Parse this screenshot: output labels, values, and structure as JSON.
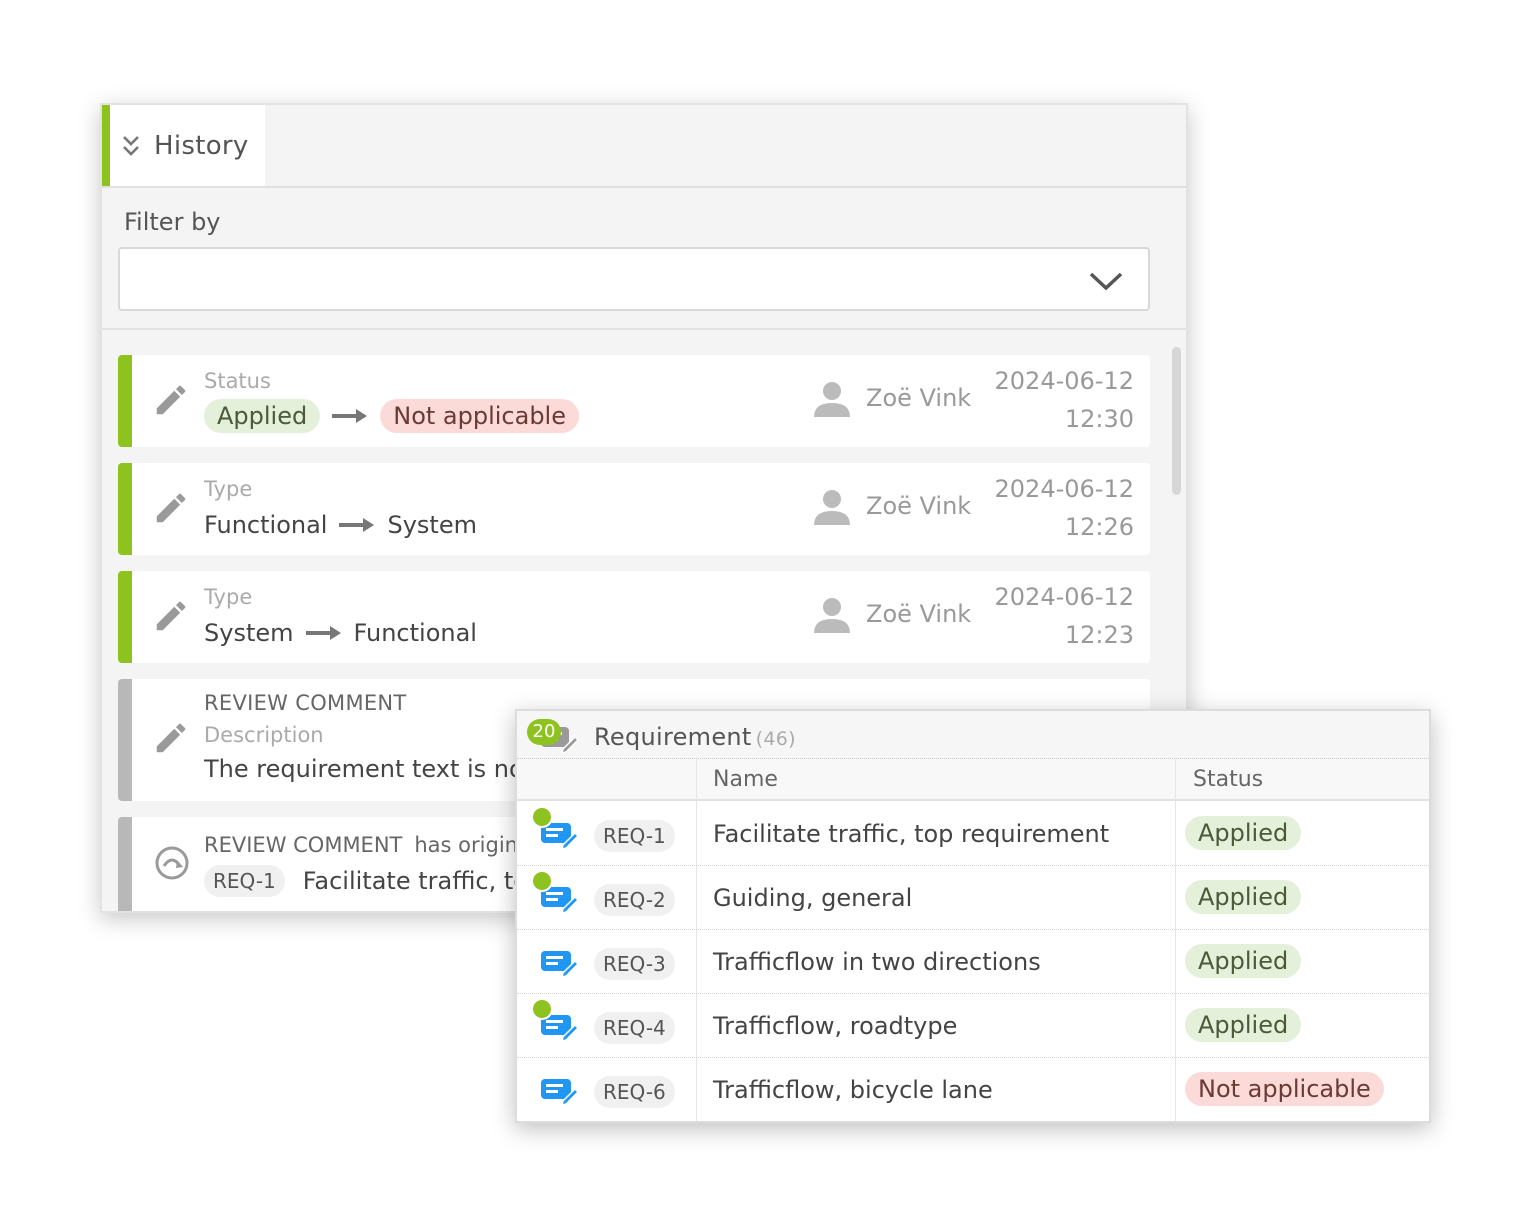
{
  "history": {
    "title": "History",
    "filter_label": "Filter by",
    "filter_value": "",
    "entries": [
      {
        "kind": "change",
        "field": "Status",
        "from": "Applied",
        "to": "Not applicable",
        "user": "Zoë Vink",
        "date": "2024-06-12",
        "time": "12:30"
      },
      {
        "kind": "change",
        "field": "Type",
        "from": "Functional",
        "to": "System",
        "user": "Zoë Vink",
        "date": "2024-06-12",
        "time": "12:26"
      },
      {
        "kind": "change",
        "field": "Type",
        "from": "System",
        "to": "Functional",
        "user": "Zoë Vink",
        "date": "2024-06-12",
        "time": "12:23"
      },
      {
        "kind": "comment",
        "heading": "REVIEW COMMENT",
        "field": "Description",
        "text": "The requirement text is not"
      },
      {
        "kind": "origin",
        "heading": "REVIEW COMMENT",
        "relation": "has origin",
        "ref_id": "REQ-1",
        "ref_name": "Facilitate traffic, top"
      }
    ]
  },
  "requirement_popup": {
    "badge": "20",
    "title": "Requirement",
    "count": "(46)",
    "columns": {
      "name": "Name",
      "status": "Status"
    },
    "rows": [
      {
        "id": "REQ-1",
        "name": "Facilitate traffic, top requirement",
        "status": "Applied",
        "has_dot": true
      },
      {
        "id": "REQ-2",
        "name": "Guiding, general",
        "status": "Applied",
        "has_dot": true
      },
      {
        "id": "REQ-3",
        "name": "Trafficflow in two directions",
        "status": "Applied",
        "has_dot": false
      },
      {
        "id": "REQ-4",
        "name": "Trafficflow, roadtype",
        "status": "Applied",
        "has_dot": true
      },
      {
        "id": "REQ-6",
        "name": "Trafficflow, bicycle lane",
        "status": "Not applicable",
        "has_dot": false
      }
    ]
  },
  "colors": {
    "accent_green": "#8dc21f",
    "applied_bg": "#e5f0da",
    "not_applicable_bg": "#fbdad7",
    "icon_blue": "#2196f3"
  }
}
